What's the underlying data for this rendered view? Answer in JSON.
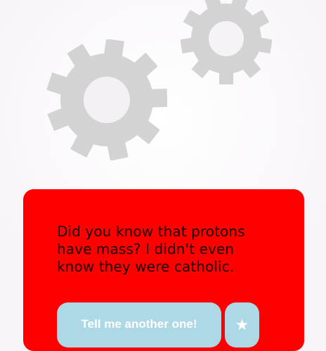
{
  "joke": {
    "text": "Did you know that protons have mass? I didn't even know they were catholic."
  },
  "buttons": {
    "next_label": "Tell me another one!",
    "favorite_label": "★"
  },
  "icons": {
    "decor_gears": [
      "gear-icon",
      "gear-icon"
    ]
  },
  "colors": {
    "background": "#f8f5f9",
    "gear": "#d3d3d3",
    "card": "#ff0000",
    "button": "#add8e6",
    "button_text": "#ffffff",
    "text": "#1a0000"
  }
}
